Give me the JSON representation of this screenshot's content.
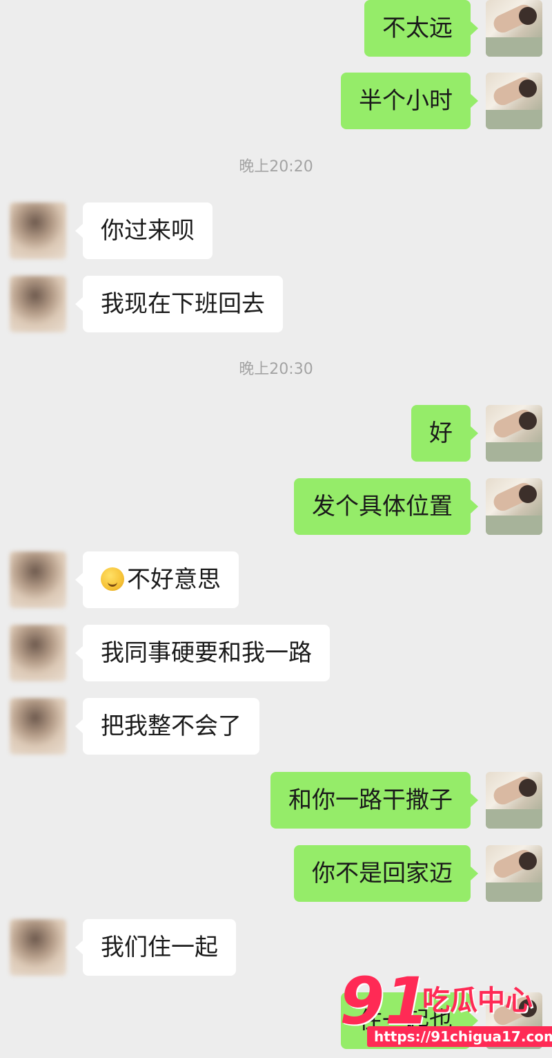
{
  "chat": {
    "messages": [
      {
        "type": "message",
        "side": "out",
        "text": "不太远",
        "emoji": ""
      },
      {
        "type": "message",
        "side": "out",
        "text": "半个小时",
        "emoji": ""
      },
      {
        "type": "time",
        "text": "晚上20:20"
      },
      {
        "type": "message",
        "side": "in",
        "text": "你过来呗",
        "emoji": ""
      },
      {
        "type": "message",
        "side": "in",
        "text": "我现在下班回去",
        "emoji": ""
      },
      {
        "type": "time",
        "text": "晚上20:30"
      },
      {
        "type": "message",
        "side": "out",
        "text": "好",
        "emoji": ""
      },
      {
        "type": "message",
        "side": "out",
        "text": "发个具体位置",
        "emoji": ""
      },
      {
        "type": "message",
        "side": "in",
        "text": "不好意思",
        "emoji": "sweat-laugh-emoji"
      },
      {
        "type": "message",
        "side": "in",
        "text": "我同事硬要和我一路",
        "emoji": ""
      },
      {
        "type": "message",
        "side": "in",
        "text": "把我整不会了",
        "emoji": ""
      },
      {
        "type": "message",
        "side": "out",
        "text": "和你一路干撒子",
        "emoji": ""
      },
      {
        "type": "message",
        "side": "out",
        "text": "你不是回家迈",
        "emoji": ""
      },
      {
        "type": "message",
        "side": "in",
        "text": "我们住一起",
        "emoji": ""
      },
      {
        "type": "message",
        "side": "out",
        "text": "住一起也",
        "emoji": ""
      }
    ]
  },
  "watermark": {
    "number": "91",
    "site_name": "吃瓜中心",
    "url": "https://91chigua17.com"
  },
  "colors": {
    "background": "#ededed",
    "outgoing_bubble": "#95ec69",
    "incoming_bubble": "#ffffff",
    "timestamp_text": "#a3a3a3",
    "watermark_accent": "#ff2a55"
  }
}
